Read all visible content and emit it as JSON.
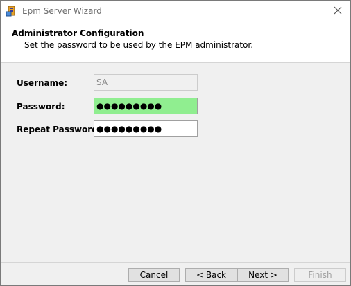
{
  "window": {
    "title": "Epm Server Wizard",
    "close_glyph": "✕"
  },
  "header": {
    "title": "Administrator Configuration",
    "subtitle": "Set the password to be used by the EPM administrator."
  },
  "form": {
    "username_label": "Username:",
    "username_value": "SA",
    "password_label": "Password:",
    "password_masked": "●●●●●●●●●",
    "repeat_label": "Repeat Password:",
    "repeat_masked": "●●●●●●●●●",
    "password_valid_color": "#90ee90"
  },
  "buttons": {
    "cancel": "Cancel",
    "back": "< Back",
    "next": "Next >",
    "finish": "Finish"
  },
  "icons": {
    "app": "app-icon",
    "close": "close-icon"
  }
}
